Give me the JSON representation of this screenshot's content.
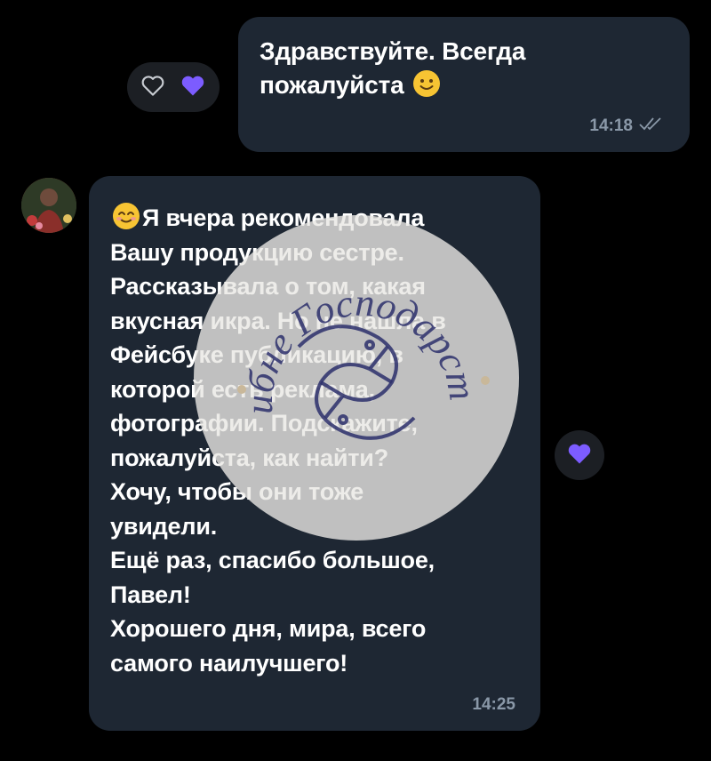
{
  "outgoing": {
    "text": "Здравствуйте. Всегда пожалуйста",
    "emoji_icon": "slightly-smiling-face-icon",
    "time": "14:18",
    "status_icon": "double-check-icon"
  },
  "outgoing_reactions": {
    "icons": [
      "heart-outline-icon",
      "heart-filled-icon"
    ]
  },
  "incoming": {
    "emoji_icon": "smiling-face-with-smiling-eyes-icon",
    "text": "Я вчера рекомендовала\nВашу продукцию сестре.\nРассказывала о том, какая\nвкусная икра. Но не нашла в\nФейсбуке публикацию, в\nкоторой есть реклама,\nфотографии. Подскажите,\nпожалуйста, как найти?\nХочу, чтобы они тоже\nувидели.\nЕщё раз, спасибо большое,\nПавел!\nХорошего дня, мира, всего\nсамого наилучшего!",
    "time": "14:25"
  },
  "incoming_reaction": {
    "icon": "heart-filled-icon"
  },
  "watermark": {
    "arc_text": "Рибне Господарство"
  },
  "colors": {
    "background": "#000000",
    "bubble": "#1e2733",
    "accent": "#7c5cff",
    "meta_text": "#8a98a8"
  }
}
